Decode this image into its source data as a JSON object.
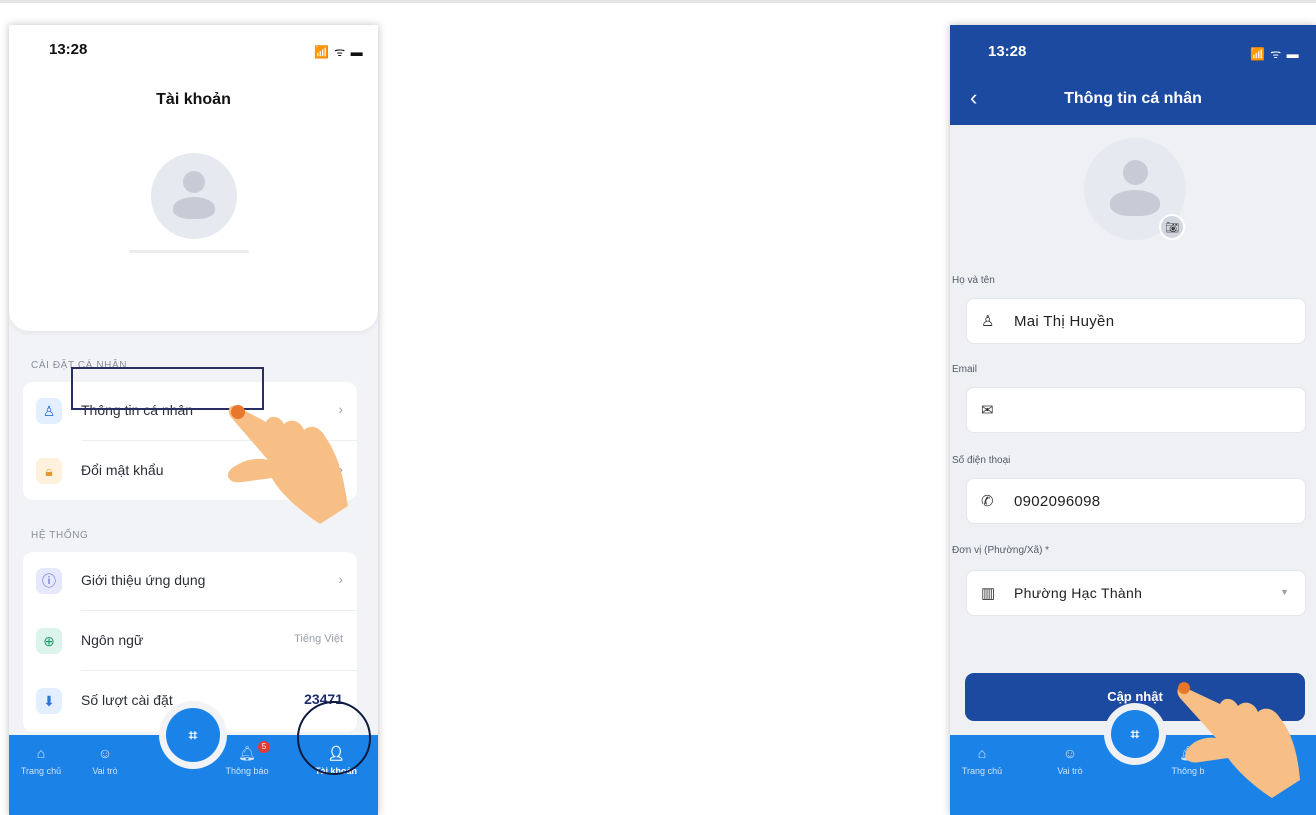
{
  "left_screen": {
    "status_time": "13:28",
    "status_icons": "📶 ᯤ ▬",
    "title": "Tài khoản",
    "sections": {
      "personal_label": "CÀI ĐẶT CÁ NHÂN",
      "system_label": "HỆ THỐNG"
    },
    "personal_items": [
      {
        "label": "Thông tin cá nhân",
        "icon": "user-icon",
        "chevron": "›"
      },
      {
        "label": "Đổi mật khẩu",
        "icon": "lock-icon",
        "chevron": "›"
      }
    ],
    "system_items": [
      {
        "label": "Giới thiệu ứng dụng",
        "icon": "info-icon",
        "chevron": "›"
      },
      {
        "label": "Ngôn ngữ",
        "icon": "globe-icon",
        "value": "Tiếng Việt"
      },
      {
        "label": "Số lượt cài đặt",
        "icon": "download-icon",
        "value": "23471"
      }
    ],
    "tabbar": {
      "home": "Trang chủ",
      "roles": "Vai trò",
      "notifications": "Thông báo",
      "notification_badge": "5",
      "account": "Tài khoản"
    }
  },
  "right_screen": {
    "status_time": "13:28",
    "status_icons": "📶 ᯤ ▬",
    "title": "Thông tin cá nhân",
    "fields": {
      "name_label": "Họ và tên",
      "name_value": "Mai Thị Huyền",
      "email_label": "Email",
      "email_value": "",
      "phone_label": "Số điện thoại",
      "phone_value": "0902096098",
      "unit_label": "Đơn vị (Phường/Xã) *",
      "unit_value": "Phường Hạc Thành"
    },
    "update_button": "Cập nhật",
    "tabbar": {
      "home": "Trang chủ",
      "roles": "Vai trò",
      "notifications": "Thông b",
      "account": "oản"
    }
  },
  "colors": {
    "tabbar_blue": "#1b82e8",
    "header_navy": "#1c4aa0",
    "highlight_outline": "#2a2f63"
  }
}
